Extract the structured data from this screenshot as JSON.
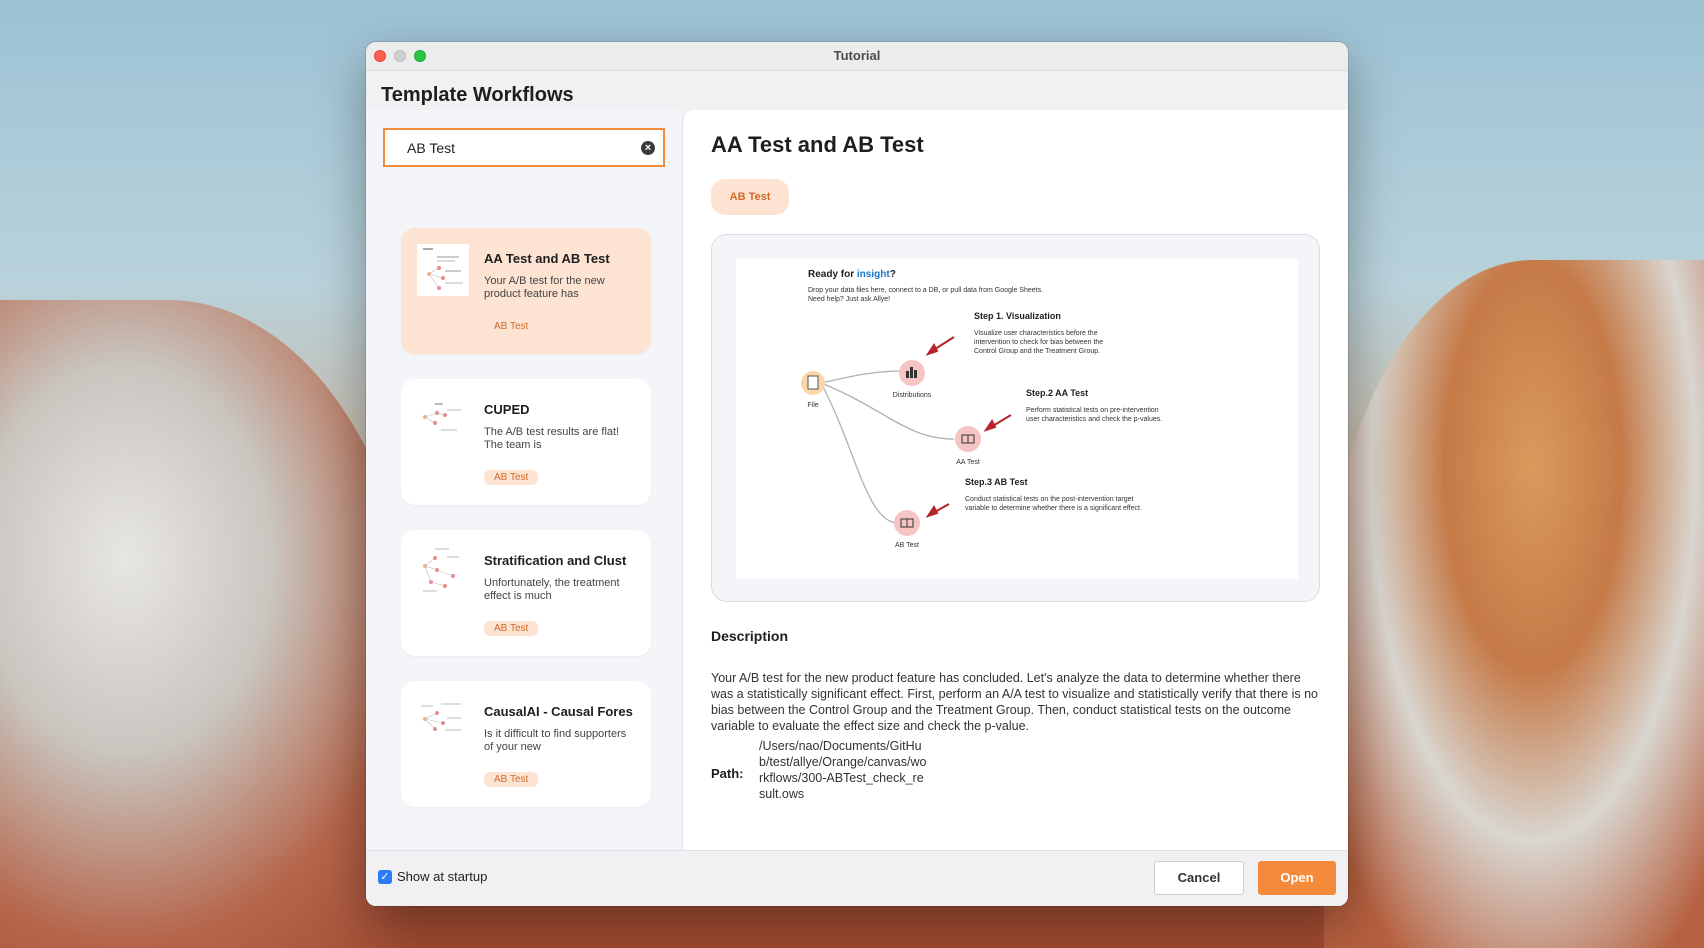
{
  "window": {
    "title": "Tutorial"
  },
  "heading": "Template Workflows",
  "search": {
    "value": "AB Test"
  },
  "cards": [
    {
      "title": "AA Test and AB Test",
      "desc": "Your A/B test for the new product feature has",
      "tag": "AB Test",
      "selected": true
    },
    {
      "title": "CUPED",
      "desc": "The A/B test results are flat! The team is",
      "tag": "AB Test",
      "selected": false
    },
    {
      "title": "Stratification and Clust",
      "desc": "Unfortunately, the treatment effect is much",
      "tag": "AB Test",
      "selected": false
    },
    {
      "title": "CausalAI - Causal Fores",
      "desc": "Is it difficult to find supporters of your new",
      "tag": "AB Test",
      "selected": false
    }
  ],
  "detail": {
    "title": "AA Test and AB Test",
    "tag": "AB Test",
    "preview": {
      "ready_prefix": "Ready for ",
      "ready_highlight": "insight",
      "ready_suffix": "?",
      "intro_1": "Drop your data files here, connect to a DB, or pull data from Google Sheets.",
      "intro_2": "Need help? Just ask Allye!",
      "step1_title": "Step 1. Visualization",
      "step1_text_1": "Visualize user characteristics before the",
      "step1_text_2": "intervention to check for bias between the",
      "step1_text_3": "Control Group and the Treatment Group.",
      "step2_title": "Step.2 AA Test",
      "step2_text_1": "Perform statistical tests on pre-intervention",
      "step2_text_2": "user characteristics and check the p-values.",
      "step3_title": "Step.3 AB Test",
      "step3_text_1": "Conduct statistical tests on the post-intervention target",
      "step3_text_2": "variable to determine whether there is a significant effect.",
      "node_file": "File",
      "node_distributions": "Distributions",
      "node_aa": "AA Test",
      "node_ab": "AB Test"
    },
    "description_heading": "Description",
    "description": "Your A/B test for the new product feature has concluded. Let's analyze the data to determine whether there was a statistically significant effect. First, perform an A/A test to visualize and statistically verify that there is no bias between the Control Group and the Treatment Group. Then, conduct statistical tests on the outcome variable to evaluate the effect size and check the p-value.",
    "path_label": "Path:",
    "path_value": "/Users/nao/Documents/GitHub/test/allye/Orange/canvas/workflows/300-ABTest_check_result.ows"
  },
  "footer": {
    "show_at_startup": "Show at startup",
    "show_at_startup_checked": true,
    "cancel": "Cancel",
    "open": "Open"
  },
  "colors": {
    "accent": "#f58a3a",
    "tag_bg": "#fde3d2",
    "tag_text": "#d26a2a",
    "link": "#1a73c9",
    "arrow": "#b5252a"
  }
}
